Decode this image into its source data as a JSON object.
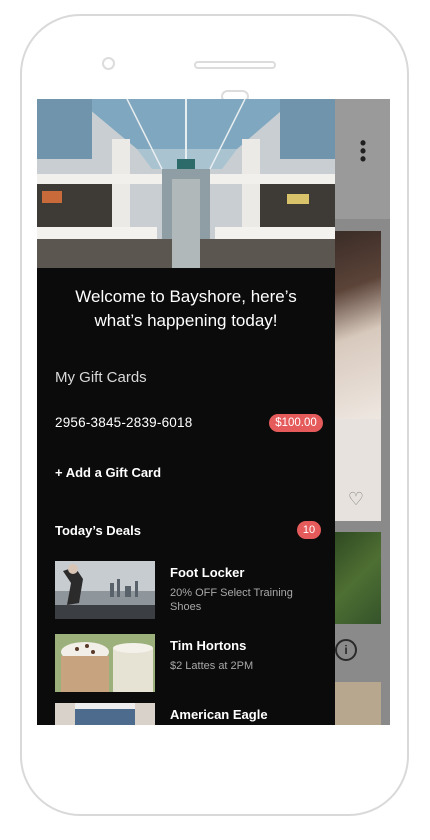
{
  "drawer": {
    "welcome_line1": "Welcome to Bayshore, here’s",
    "welcome_line2": "what’s happening today!",
    "gift_cards_label": "My Gift Cards",
    "gift_card": {
      "number": "2956-3845-2839-6018",
      "balance": "$100.00"
    },
    "add_gift_card": "+ Add a Gift Card",
    "deals_label": "Today’s Deals",
    "deals_count": "10",
    "deals": [
      {
        "title": "Foot Locker",
        "description": "20% OFF Select Training Shoes"
      },
      {
        "title": "Tim Hortons",
        "description": "$2 Lattes at 2PM"
      },
      {
        "title": "American Eagle",
        "description": ""
      }
    ]
  },
  "background": {
    "menu_icon": "kebab-menu-icon",
    "favorite_icon": "heart-icon",
    "info_icon": "info-icon"
  },
  "colors": {
    "badge": "#e55b5b",
    "drawer": "#0b0b0b"
  }
}
